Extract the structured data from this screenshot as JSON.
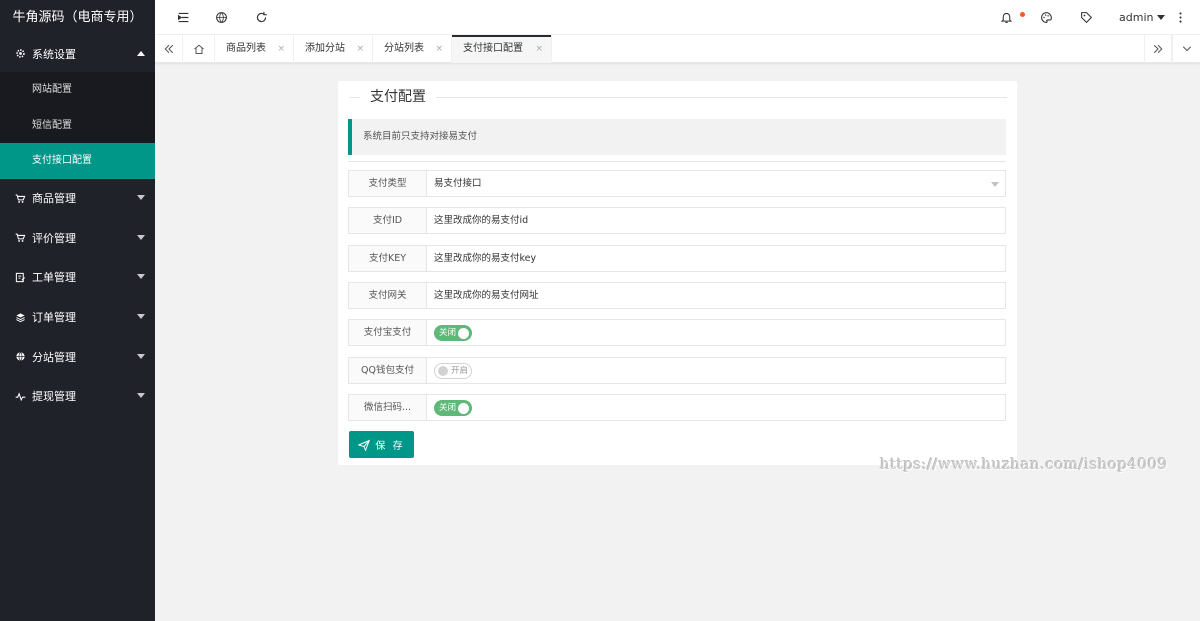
{
  "sidebar": {
    "logo": "牛角源码（电商专用）",
    "groups": [
      {
        "label": "系统设置",
        "expanded": true,
        "icon": "gear-icon",
        "items": [
          {
            "label": "网站配置",
            "active": false
          },
          {
            "label": "短信配置",
            "active": false
          },
          {
            "label": "支付接口配置",
            "active": true
          }
        ]
      },
      {
        "label": "商品管理",
        "icon": "cart-icon"
      },
      {
        "label": "评价管理",
        "icon": "cart-icon"
      },
      {
        "label": "工单管理",
        "icon": "ticket-icon"
      },
      {
        "label": "订单管理",
        "icon": "layers-icon"
      },
      {
        "label": "分站管理",
        "icon": "globe-icon"
      },
      {
        "label": "提现管理",
        "icon": "pulse-icon"
      }
    ]
  },
  "header": {
    "user": "admin"
  },
  "tabs": [
    {
      "label": "商品列表",
      "close": "×"
    },
    {
      "label": "添加分站",
      "close": "×"
    },
    {
      "label": "分站列表",
      "close": "×"
    },
    {
      "label": "支付接口配置",
      "close": "×",
      "active": true
    }
  ],
  "card": {
    "title": "支付配置",
    "notice": "系统目前只支持对接易支付",
    "fields": {
      "pay_type": {
        "label": "支付类型",
        "value": "易支付接口"
      },
      "pay_id": {
        "label": "支付ID",
        "value": "这里改成你的易支付id"
      },
      "pay_key": {
        "label": "支付KEY",
        "value": "这里改成你的易支付key"
      },
      "pay_gateway": {
        "label": "支付网关",
        "value": "这里改成你的易支付网址"
      },
      "alipay": {
        "label": "支付宝支付",
        "switch_text": "关闭",
        "on": true
      },
      "qq": {
        "label": "QQ钱包支付",
        "switch_text": "开启",
        "on": false
      },
      "wechat": {
        "label": "微信扫码...",
        "switch_text": "关闭",
        "on": true
      }
    },
    "save_label": "保 存"
  },
  "watermark": "https://www.huzhan.com/ishop4009",
  "colors": {
    "sidebar_bg": "#20222a",
    "accent": "#009688",
    "switch_on": "#5fb878",
    "badge": "#ff5722"
  }
}
